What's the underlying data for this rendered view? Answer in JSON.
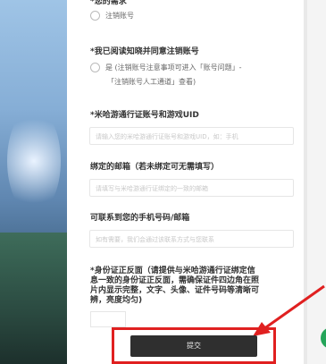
{
  "form": {
    "q1": "*您的需求",
    "q1_option": "注销账号",
    "q2": "*我已阅读知晓并同意注销账号",
    "q2_option_line1": "是 (注销账号注意事项可进入「账号问题」-",
    "q2_option_line2": "「注销账号人工通道」查看)",
    "q3": "*米哈游通行证账号和游戏UID",
    "q3_placeholder": "请输入您的米哈游通行证账号和游戏UID，如：手机",
    "q4": "绑定的邮箱（若未绑定可无需填写）",
    "q4_placeholder": "请填写与米哈游通行证绑定的一致的邮箱",
    "q5": "可联系到您的手机号码/邮箱",
    "q5_placeholder": "如有需要，我们会通过该联系方式与您联系",
    "q6_line1": "*身份证正反面（请提供与米哈游通行证绑定信",
    "q6_line2": "息一致的身份证正反面，需确保证件四边角在照",
    "q6_line3": "片内显示完整，文字、头像、证件号码等清晰可",
    "q6_line4": "辨，亮度均匀)",
    "submit_label": "提交"
  },
  "colors": {
    "annotation_red": "#e02020",
    "submit_bg": "#2f2f2f"
  }
}
